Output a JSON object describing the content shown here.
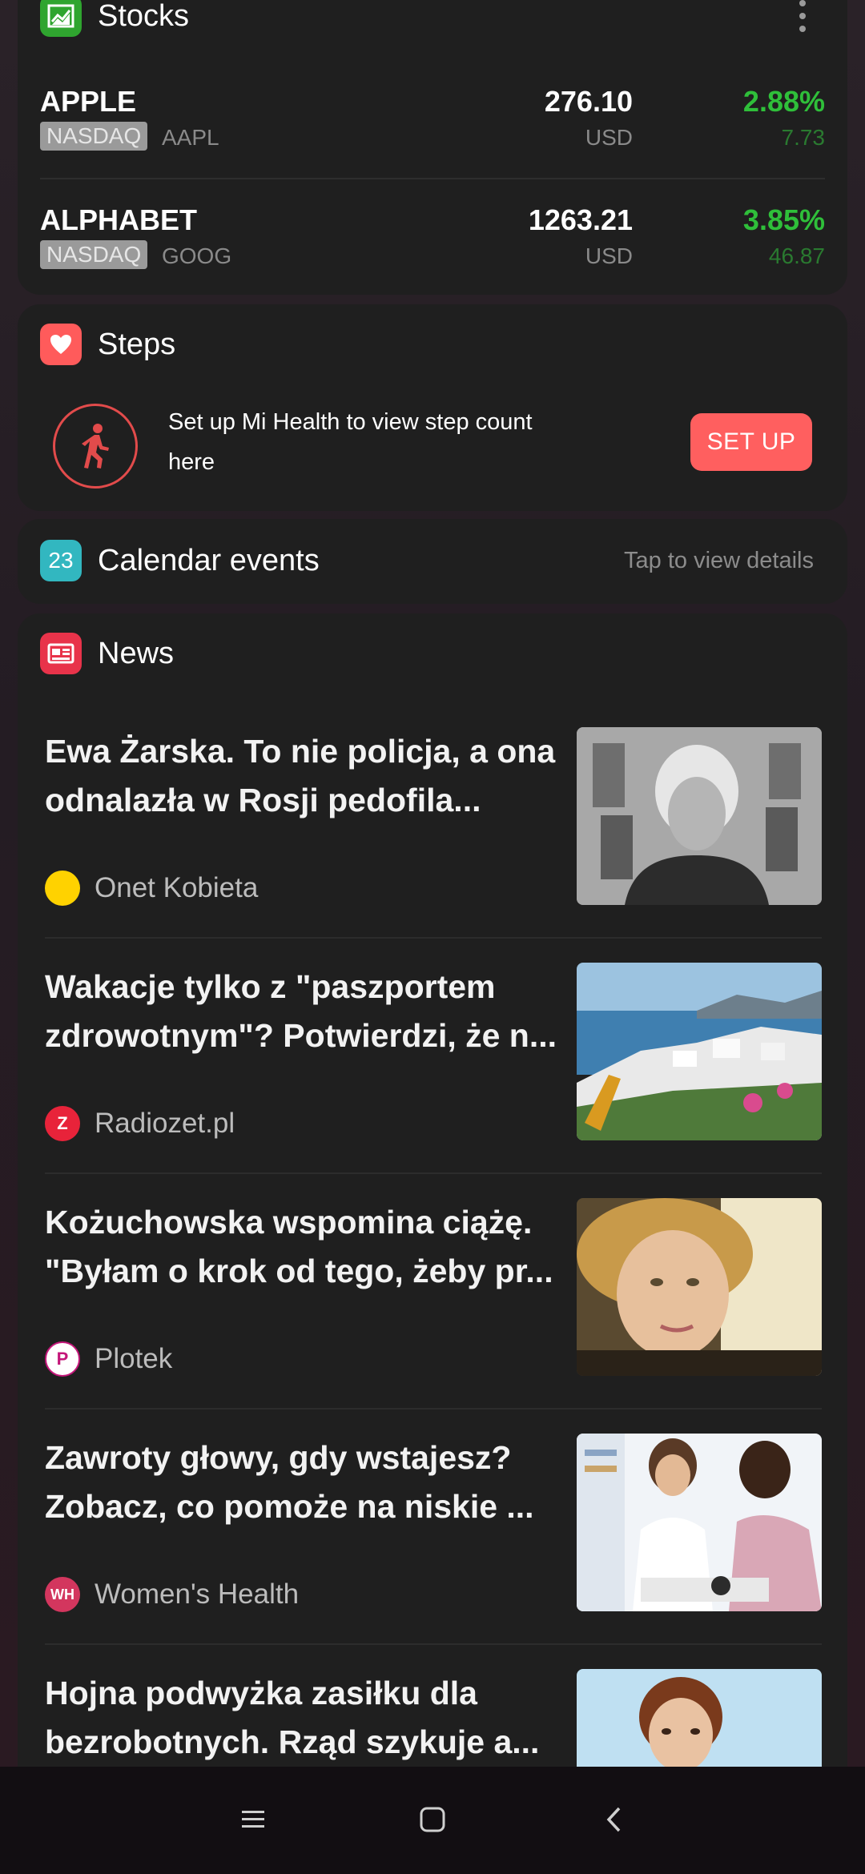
{
  "stocks": {
    "title": "Stocks",
    "icon": "stocks-chart-icon",
    "items": [
      {
        "name": "APPLE",
        "exchange": "NASDAQ",
        "ticker": "AAPL",
        "price": "276.10",
        "currency": "USD",
        "change_pct": "2.88%",
        "change": "7.73"
      },
      {
        "name": "ALPHABET",
        "exchange": "NASDAQ",
        "ticker": "GOOG",
        "price": "1263.21",
        "currency": "USD",
        "change_pct": "3.85%",
        "change": "46.87"
      }
    ]
  },
  "steps": {
    "title": "Steps",
    "icon": "heart-icon",
    "message": "Set up Mi Health to view step count here",
    "button": "SET UP"
  },
  "calendar": {
    "title": "Calendar events",
    "icon_day": "23",
    "hint": "Tap to view details"
  },
  "news": {
    "title": "News",
    "items": [
      {
        "headline": "Ewa Żarska. To nie policja, a ona odnalazła w Rosji pedofila...",
        "source": "Onet Kobieta"
      },
      {
        "headline": "Wakacje tylko z \"paszportem zdrowotnym\"? Potwierdzi, że n...",
        "source": "Radiozet.pl"
      },
      {
        "headline": "Kożuchowska wspomina ciążę. \"Byłam o krok od tego, żeby pr...",
        "source": "Plotek"
      },
      {
        "headline": "Zawroty głowy, gdy wstajesz? Zobacz, co pomoże na niskie ...",
        "source": "Women's Health"
      },
      {
        "headline": "Hojna podwyżka zasiłku dla bezrobotnych. Rząd szykuje a...",
        "source": ""
      }
    ]
  },
  "colors": {
    "positive": "#2fbf3a",
    "accent_red": "#ff5f5f",
    "card_bg": "#1f1f1f"
  }
}
